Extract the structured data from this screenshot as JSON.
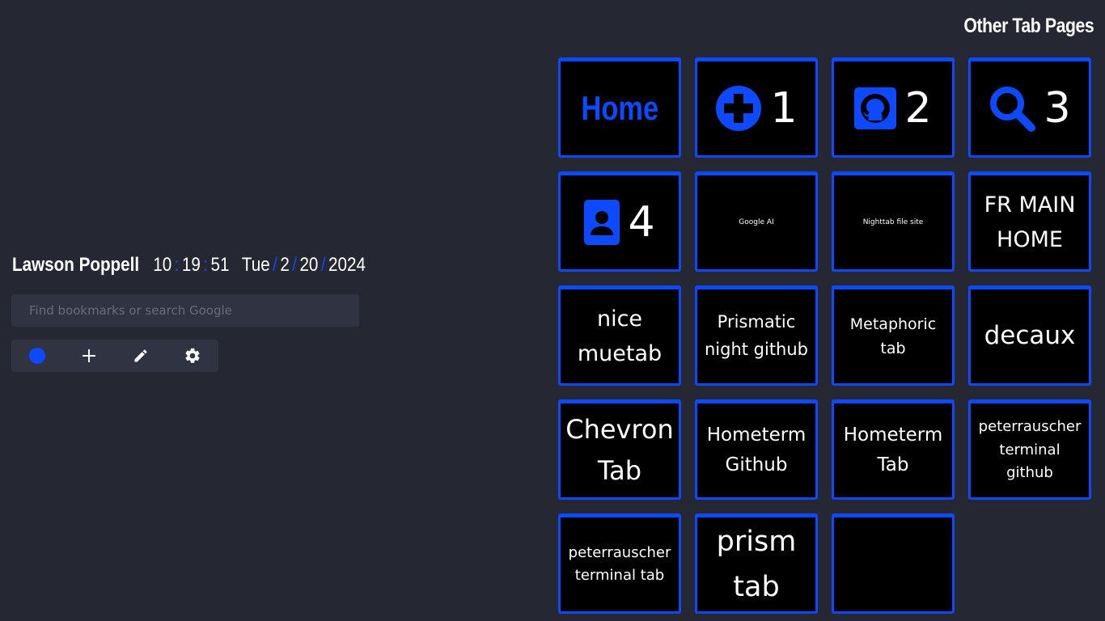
{
  "header": {
    "name": "Lawson Poppell",
    "time": {
      "hours": "10",
      "minutes": "19",
      "seconds": "51",
      "separator": ":"
    },
    "date": {
      "weekday": "Tue",
      "month": "2",
      "day": "20",
      "year": "2024",
      "separator": "/"
    }
  },
  "search": {
    "placeholder": "Find bookmarks or search Google",
    "value": ""
  },
  "toolbar": {
    "icons": [
      "theme-accent-dot",
      "plus-icon",
      "pencil-icon",
      "gear-icon"
    ]
  },
  "section_title": "Other Tab Pages",
  "colors": {
    "accent": "#0c49ff",
    "background": "#252832",
    "tile_background": "#000000",
    "panel": "#2f3342"
  },
  "tiles": [
    {
      "label": "Home"
    },
    {
      "icon": "plus-circle-icon",
      "label": "1"
    },
    {
      "icon": "github-icon",
      "label": "2"
    },
    {
      "icon": "search-icon",
      "label": "3"
    },
    {
      "icon": "contact-icon",
      "label": "4"
    },
    {
      "label": "Google AI"
    },
    {
      "label": "Nighttab file site"
    },
    {
      "label": "FR MAIN HOME"
    },
    {
      "label": "nice muetab"
    },
    {
      "label": "Prismatic night github"
    },
    {
      "label": "Metaphoric tab"
    },
    {
      "label": "decaux"
    },
    {
      "label": "Chevron Tab"
    },
    {
      "label": "Hometerm Github"
    },
    {
      "label": "Hometerm Tab"
    },
    {
      "label": "peterrauscher terminal github"
    },
    {
      "label": "peterrauscher terminal tab"
    },
    {
      "label": "prism tab"
    },
    {
      "label": ""
    }
  ]
}
